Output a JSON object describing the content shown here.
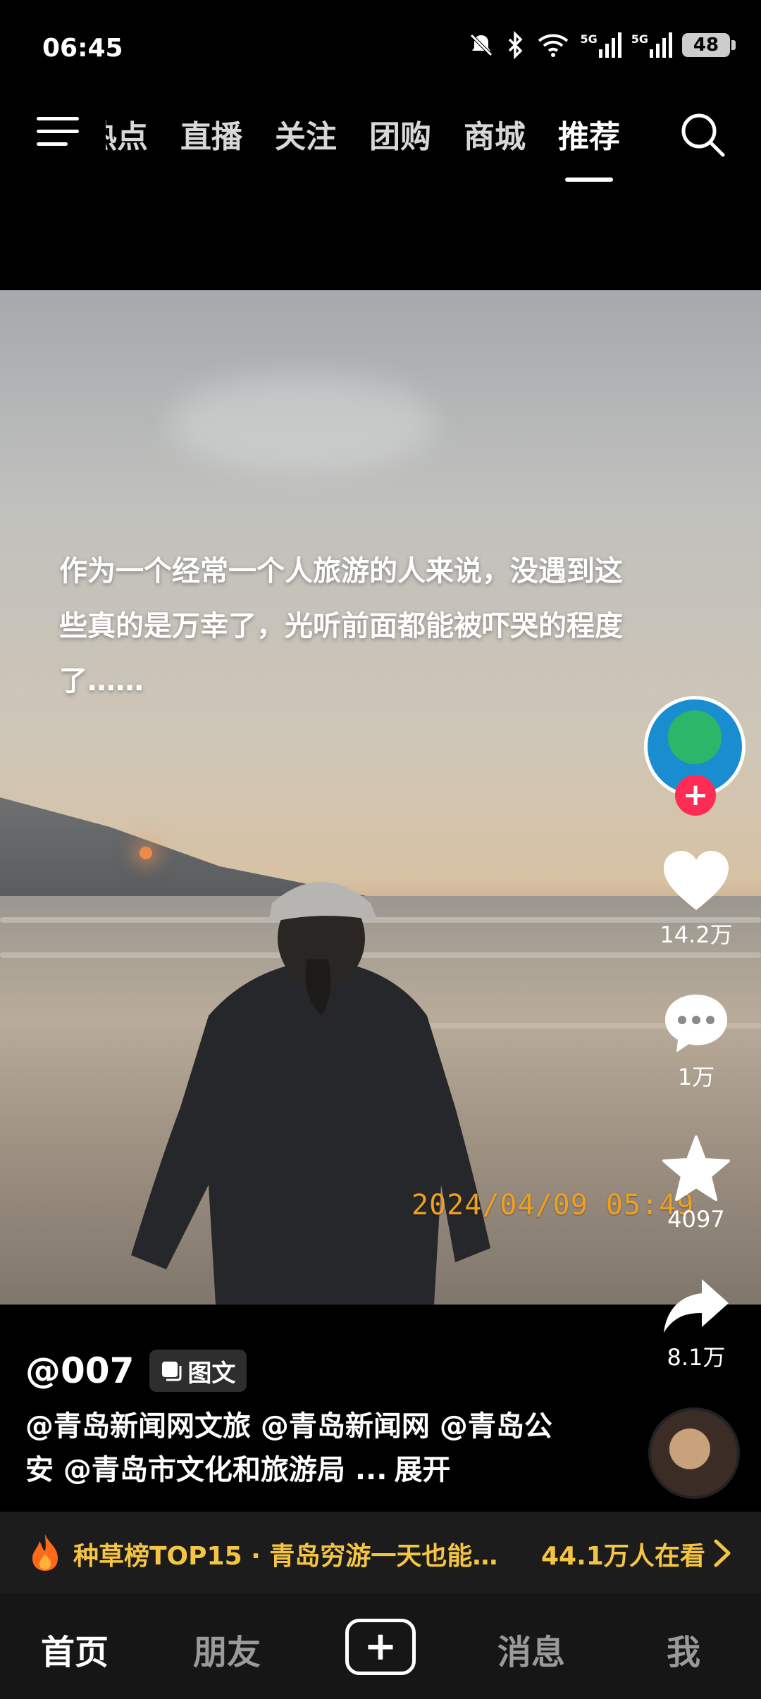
{
  "status_bar": {
    "time": "06:45",
    "battery": "48",
    "network_1": "5G",
    "network_2": "5G"
  },
  "top_nav": {
    "tabs": [
      "热点",
      "直播",
      "关注",
      "团购",
      "商城",
      "推荐"
    ],
    "active_tab": "推荐"
  },
  "post": {
    "caption": "作为一个经常一个人旅游的人来说，没遇到这些真的是万幸了，光听前面都能被吓哭的程度了……",
    "timestamp": "2024/04/09  05:49",
    "author": "@007",
    "type_badge": "图文",
    "description": "@青岛新闻网文旅 @青岛新闻网 @青岛公安 @青岛市文化和旅游局 ...",
    "expand_label": "展开"
  },
  "actions": {
    "likes": "14.2万",
    "comments": "1万",
    "favorites": "4097",
    "shares": "8.1万"
  },
  "hot_bar": {
    "title": "种草榜TOP15 · 青岛穷游一天也能…",
    "viewers": "44.1万人在看"
  },
  "bottom_nav": {
    "home": "首页",
    "friends": "朋友",
    "post": "+",
    "messages": "消息",
    "me": "我"
  },
  "colors": {
    "accent_red": "#fe2c55",
    "hot_yellow": "#f5c542",
    "timestamp_orange": "#f0a020"
  },
  "icons": [
    "menu-icon",
    "search-icon",
    "heart-icon",
    "comment-icon",
    "star-icon",
    "share-icon",
    "fire-icon",
    "chevron-right-icon"
  ]
}
